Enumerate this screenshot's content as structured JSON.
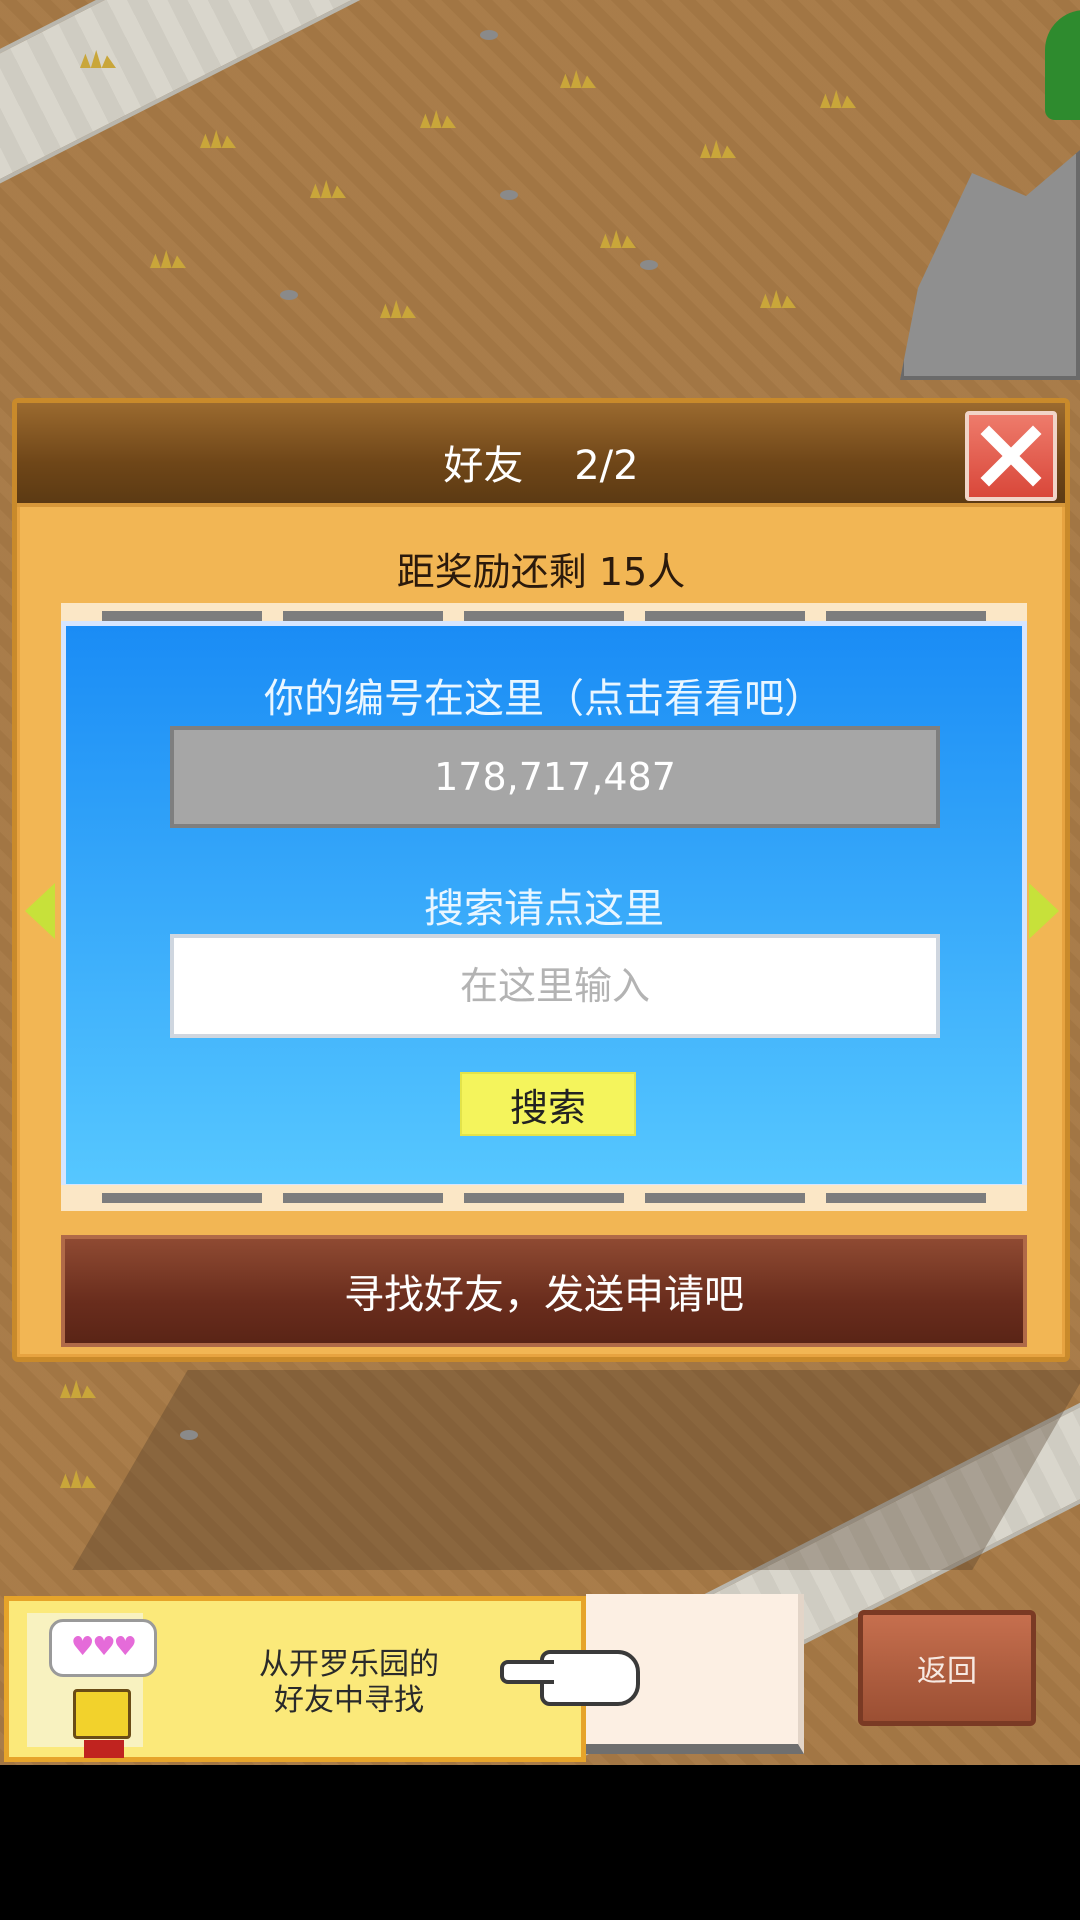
{
  "dialog": {
    "title": "好友    2/2",
    "reward_text": "距奖励还剩 15人",
    "close_icon": "close-icon"
  },
  "id_section": {
    "label": "你的编号在这里（点击看看吧）",
    "player_id": "178,717,487"
  },
  "search_section": {
    "label": "搜索请点这里",
    "placeholder": "在这里输入",
    "button_label": "搜索"
  },
  "find_friends_label": "寻找好友，发送申请吧",
  "bottom": {
    "kairo_text": "从开罗乐园的\n好友中寻找",
    "hearts": "♥♥♥",
    "back_label": "返回"
  },
  "colors": {
    "panel_orange": "#f2b654",
    "header_brown": "#6f4618",
    "panel_blue": "#1a8cf5",
    "close_red": "#d9473a",
    "search_yellow": "#f4f45c",
    "find_bar_brown": "#6a2d1d"
  },
  "icons": [
    "close-icon",
    "arrow-left-icon",
    "arrow-right-icon",
    "pointing-hand-icon",
    "hearts-icon",
    "character-avatar"
  ]
}
